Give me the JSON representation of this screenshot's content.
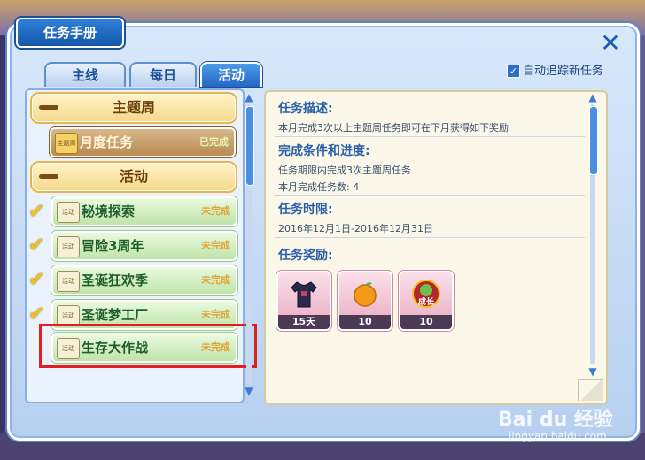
{
  "window": {
    "title": "任务手册"
  },
  "tabs": [
    {
      "label": "主线",
      "active": false
    },
    {
      "label": "每日",
      "active": false
    },
    {
      "label": "活动",
      "active": true
    }
  ],
  "auto_track": {
    "label": "自动追踪新任务",
    "checked": true
  },
  "categories": [
    {
      "label": "主题周",
      "quests": [
        {
          "icon_text": "主题周",
          "name": "月度任务",
          "status": "已完成",
          "checked": false
        }
      ]
    },
    {
      "label": "活动",
      "quests": [
        {
          "icon_text": "活动",
          "name": "秘境探索",
          "status": "未完成",
          "checked": true
        },
        {
          "icon_text": "活动",
          "name": "冒险3周年",
          "status": "未完成",
          "checked": true
        },
        {
          "icon_text": "活动",
          "name": "圣诞狂欢季",
          "status": "未完成",
          "checked": true
        },
        {
          "icon_text": "活动",
          "name": "圣诞梦工厂",
          "status": "未完成",
          "checked": true
        },
        {
          "icon_text": "活动",
          "name": "生存大作战",
          "status": "未完成",
          "checked": false
        }
      ]
    }
  ],
  "detail": {
    "desc_title": "任务描述:",
    "desc_text": "本月完成3次以上主题周任务即可在下月获得如下奖励",
    "cond_title": "完成条件和进度:",
    "cond_text1": "任务期限内完成3次主题周任务",
    "cond_text2": "本月完成任务数: 4",
    "time_title": "任务时限:",
    "time_text": "2016年12月1日-2016年12月31日",
    "reward_title": "任务奖励:",
    "rewards": [
      {
        "icon": "shirt-icon",
        "qty": "15天"
      },
      {
        "icon": "orange-fruit-icon",
        "qty": "10"
      },
      {
        "icon": "growth-badge-icon",
        "badge_text": "成长",
        "qty": "10"
      }
    ]
  },
  "watermark": {
    "text": "Bai du 经验",
    "url": "jingyan.baidu.com"
  },
  "colors": {
    "accent": "#2467c4",
    "highlight": "#e02020",
    "header_gold": "#f4d98a"
  }
}
